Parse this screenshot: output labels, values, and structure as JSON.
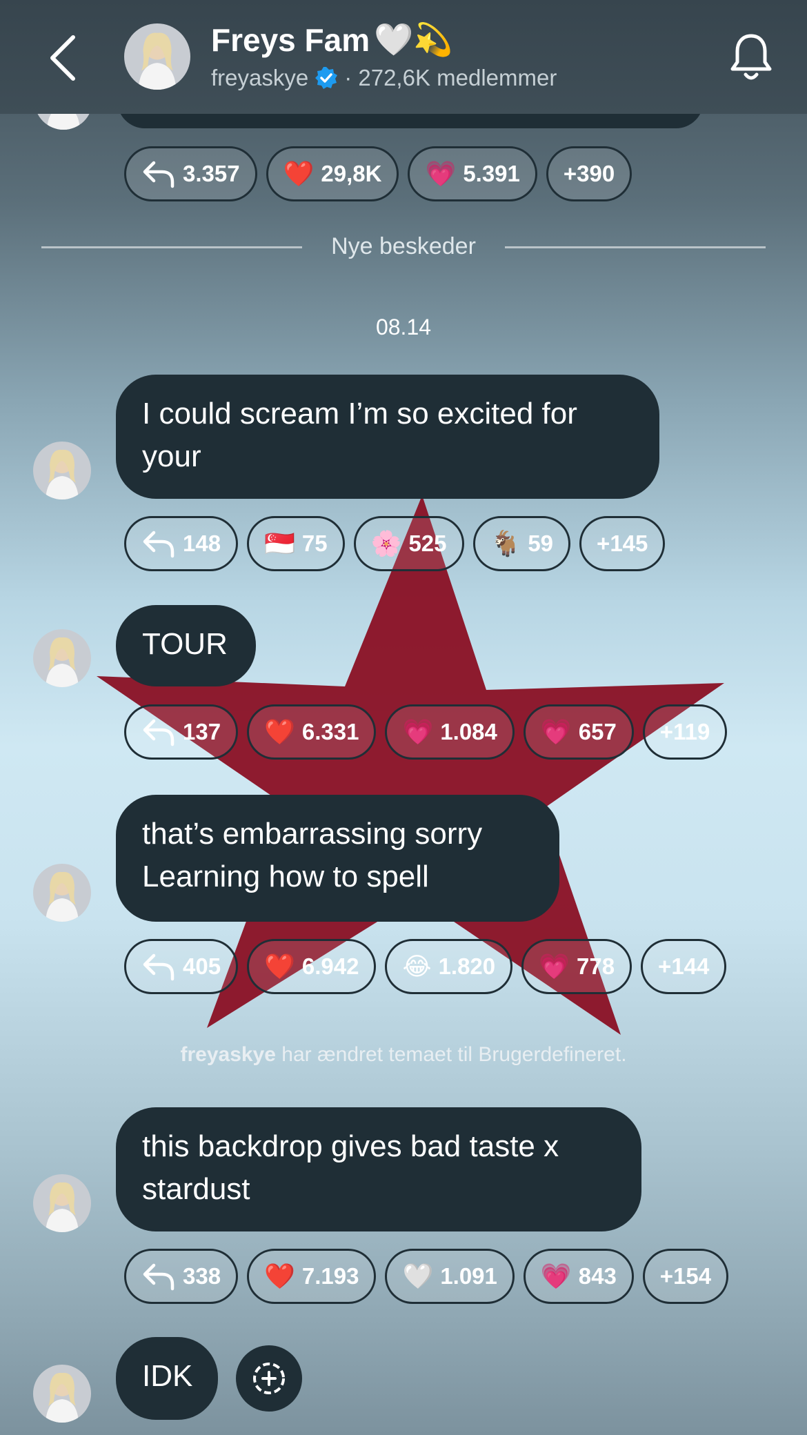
{
  "header": {
    "title": "Freys Fam",
    "title_emoji": "🤍💫",
    "handle": "freyaskye",
    "members": "· 272,6K medlemmer"
  },
  "top_reactions": [
    {
      "kind": "reply",
      "count": "3.357"
    },
    {
      "kind": "emoji",
      "emoji": "❤️",
      "count": "29,8K"
    },
    {
      "kind": "emoji",
      "emoji": "💗",
      "count": "5.391"
    },
    {
      "kind": "more",
      "count": "+390"
    }
  ],
  "divider_label": "Nye beskeder",
  "timestamp": "08.14",
  "messages": [
    {
      "text": "I could scream I’m so excited for your",
      "reactions": [
        {
          "kind": "reply",
          "count": "148"
        },
        {
          "kind": "emoji",
          "emoji": "🇸🇬",
          "count": "75"
        },
        {
          "kind": "emoji",
          "emoji": "🌸",
          "count": "525"
        },
        {
          "kind": "emoji",
          "emoji": "🐐",
          "count": "59"
        },
        {
          "kind": "more",
          "count": "+145"
        }
      ]
    },
    {
      "text": "TOUR",
      "reactions": [
        {
          "kind": "reply",
          "count": "137"
        },
        {
          "kind": "emoji",
          "emoji": "❤️",
          "count": "6.331"
        },
        {
          "kind": "emoji",
          "emoji": "💗",
          "count": "1.084"
        },
        {
          "kind": "emoji",
          "emoji": "💗",
          "count": "657"
        },
        {
          "kind": "more",
          "count": "+119"
        }
      ]
    },
    {
      "text": "that’s embarrassing sorry\nLearning how to spell",
      "reactions": [
        {
          "kind": "reply",
          "count": "405"
        },
        {
          "kind": "emoji",
          "emoji": "❤️",
          "count": "6.942"
        },
        {
          "kind": "emoji",
          "emoji": "😂",
          "count": "1.820"
        },
        {
          "kind": "emoji",
          "emoji": "💗",
          "count": "778"
        },
        {
          "kind": "more",
          "count": "+144"
        }
      ]
    },
    {
      "text": "this backdrop gives bad taste x stardust",
      "reactions": [
        {
          "kind": "reply",
          "count": "338"
        },
        {
          "kind": "emoji",
          "emoji": "❤️",
          "count": "7.193"
        },
        {
          "kind": "emoji",
          "emoji": "🤍",
          "count": "1.091"
        },
        {
          "kind": "emoji",
          "emoji": "💗",
          "count": "843"
        },
        {
          "kind": "more",
          "count": "+154"
        }
      ]
    },
    {
      "text": "IDK",
      "reactions": []
    }
  ],
  "system_message": {
    "user": "freyaskye",
    "text": " har ændret temaet til Brugerdefineret."
  },
  "colors": {
    "bubble": "#1f2e36",
    "star": "#8a1024",
    "verified": "#1d9bf0"
  }
}
